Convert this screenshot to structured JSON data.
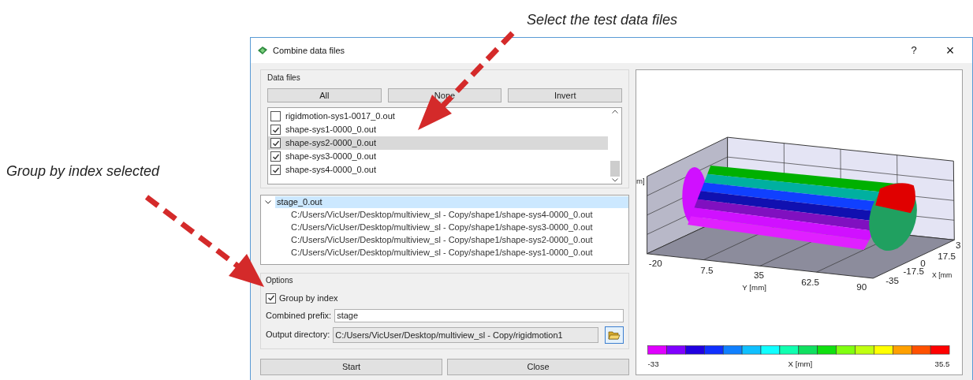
{
  "annotations": [
    {
      "text": "Select the test data files"
    },
    {
      "text": "Group by index selected"
    }
  ],
  "window": {
    "title": "Combine data files",
    "help": "?",
    "close": "×"
  },
  "data_files": {
    "title": "Data files",
    "buttons": [
      "All",
      "None",
      "Invert"
    ],
    "files": [
      {
        "name": "rigidmotion-sys1-0017_0.out",
        "checked": false,
        "selected": false
      },
      {
        "name": "shape-sys1-0000_0.out",
        "checked": true,
        "selected": false
      },
      {
        "name": "shape-sys2-0000_0.out",
        "checked": true,
        "selected": true
      },
      {
        "name": "shape-sys3-0000_0.out",
        "checked": true,
        "selected": false
      },
      {
        "name": "shape-sys4-0000_0.out",
        "checked": true,
        "selected": false
      }
    ]
  },
  "tree": {
    "label": "stage_0.out",
    "expanded": true,
    "selected": true,
    "children": [
      {
        "label": "C:/Users/VicUser/Desktop/multiview_sl - Copy/shape1/shape-sys4-0000_0.out"
      },
      {
        "label": "C:/Users/VicUser/Desktop/multiview_sl - Copy/shape1/shape-sys3-0000_0.out"
      },
      {
        "label": "C:/Users/VicUser/Desktop/multiview_sl - Copy/shape1/shape-sys2-0000_0.out"
      },
      {
        "label": "C:/Users/VicUser/Desktop/multiview_sl - Copy/shape1/shape-sys1-0000_0.out"
      }
    ]
  },
  "options": {
    "title": "Options",
    "group_by_index": {
      "label": "Group by index",
      "checked": true
    },
    "combined_prefix": {
      "label": "Combined prefix:",
      "value": "stage"
    },
    "output_directory": {
      "label": "Output directory:",
      "value": "C:/Users/VicUser/Desktop/multiview_sl - Copy/rigidmotion1"
    }
  },
  "buttons": [
    "Start",
    "Close"
  ],
  "plot": {
    "y_ticks": [
      "-20",
      "7.5",
      "35",
      "62.5",
      "90"
    ],
    "y_label": "Y [mm]",
    "x_ticks": [
      "3",
      "17.5",
      "0",
      "-17.5",
      "-35"
    ],
    "x_label": "X [mm",
    "z_label": "m]",
    "colorbar": {
      "min": "-33",
      "label": "X [mm]",
      "max": "35.5"
    }
  }
}
